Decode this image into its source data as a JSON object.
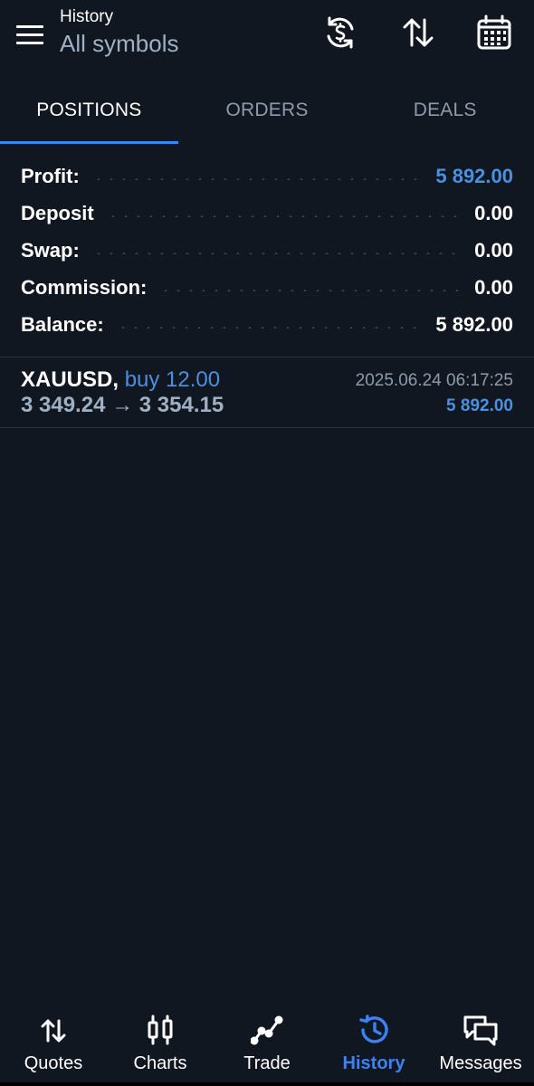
{
  "header": {
    "title": "History",
    "subtitle": "All symbols",
    "icons": [
      "currency-exchange-icon",
      "sort-icon",
      "calendar-icon"
    ]
  },
  "tabs": [
    {
      "label": "POSITIONS",
      "active": true
    },
    {
      "label": "ORDERS",
      "active": false
    },
    {
      "label": "DEALS",
      "active": false
    }
  ],
  "summary": {
    "profit": {
      "label": "Profit:",
      "value": "5 892.00"
    },
    "deposit": {
      "label": "Deposit",
      "value": "0.00"
    },
    "swap": {
      "label": "Swap:",
      "value": "0.00"
    },
    "commission": {
      "label": "Commission:",
      "value": "0.00"
    },
    "balance": {
      "label": "Balance:",
      "value": "5 892.00"
    }
  },
  "positions": [
    {
      "symbol": "XAUUSD,",
      "direction": "buy 12.00",
      "prices": "3 349.24 → 3 354.15",
      "time": "2025.06.24 06:17:25",
      "profit": "5 892.00"
    }
  ],
  "nav": [
    {
      "label": "Quotes",
      "icon": "quotes-icon",
      "active": false
    },
    {
      "label": "Charts",
      "icon": "charts-icon",
      "active": false
    },
    {
      "label": "Trade",
      "icon": "trade-icon",
      "active": false
    },
    {
      "label": "History",
      "icon": "history-icon",
      "active": true
    },
    {
      "label": "Messages",
      "icon": "messages-icon",
      "active": false
    }
  ],
  "colors": {
    "background": "#111720",
    "accent": "#3b82f6",
    "profit": "#4a90e2",
    "muted": "#8e9bab"
  }
}
